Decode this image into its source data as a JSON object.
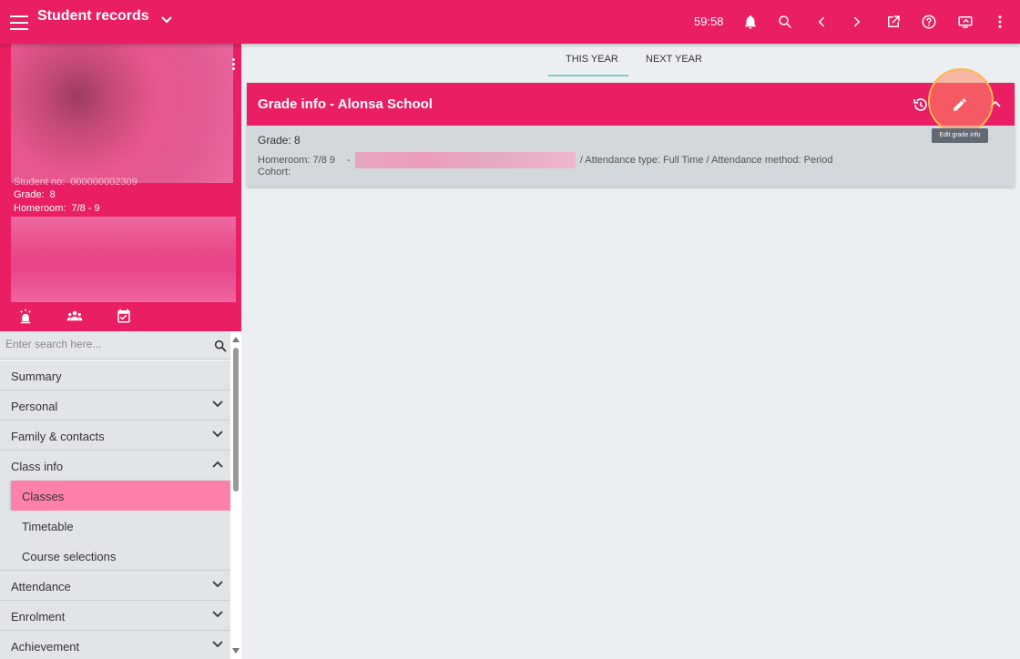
{
  "topbar": {
    "title": "Student records",
    "timer": "59:58",
    "icons": [
      "menu-icon",
      "chevron-down-icon",
      "bell-icon",
      "search-icon",
      "chevron-left-icon",
      "chevron-right-icon",
      "open-external-icon",
      "help-icon",
      "screen-share-icon",
      "more-vert-icon"
    ]
  },
  "profile": {
    "student_no_label": "Student no:",
    "student_no": "000000002309",
    "grade_label": "Grade:",
    "grade": "8",
    "homeroom_label": "Homeroom:",
    "homeroom": "7/8 - 9",
    "quick_icons": [
      "alert-icon",
      "group-icon",
      "calendar-check-icon"
    ]
  },
  "search": {
    "placeholder": "Enter search here..."
  },
  "nav": {
    "summary": "Summary",
    "personal": "Personal",
    "family": "Family & contacts",
    "class_info": "Class info",
    "classes": "Classes",
    "timetable": "Timetable",
    "course_selections": "Course selections",
    "attendance": "Attendance",
    "enrolment": "Enrolment",
    "achievement": "Achievement"
  },
  "tabs": {
    "this_year": "THIS YEAR",
    "next_year": "NEXT YEAR"
  },
  "card": {
    "title": "Grade info - Alonsa School",
    "grade_text": "Grade: 8",
    "homeroom_text": "Homeroom: 7/8 9",
    "dash": "-",
    "after_blur": "/  Attendance type: Full Time  /  Attendance method: Period",
    "cohort_text": "Cohort:",
    "tooltip": "Edit grade info"
  },
  "colors": {
    "brand": "#e91e63",
    "active_item": "#ff80ab",
    "tab_underline": "#80cbc4",
    "highlight": "#ffb74d"
  }
}
